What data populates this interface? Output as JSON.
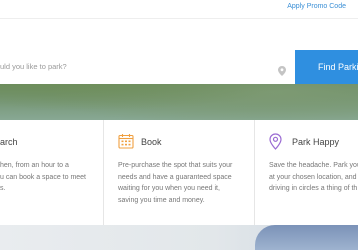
{
  "header": {
    "promo_link": "Apply Promo Code"
  },
  "search": {
    "placeholder": "uld you like to park?",
    "button_label": "Find Parkin"
  },
  "features": [
    {
      "title": "arch",
      "text_lines": [
        "hen, from an hour to a",
        "u can book a space to meet",
        "s."
      ]
    },
    {
      "title": "Book",
      "text_lines": [
        "Pre-purchase the spot that suits your",
        "needs and have a guaranteed space",
        "waiting for you when you need it,",
        "saving you time and money."
      ]
    },
    {
      "title": "Park Happy",
      "text_lines": [
        "Save the headache. Park you",
        "at your chosen location, and",
        "driving in circles a thing of th"
      ]
    }
  ],
  "colors": {
    "accent": "#2f8fe0",
    "icon_orange": "#f0a040",
    "icon_purple": "#9b6cd3"
  },
  "icons": {
    "search_field": "map-pin-icon",
    "book": "calendar-icon",
    "park_happy": "location-pin-icon"
  }
}
